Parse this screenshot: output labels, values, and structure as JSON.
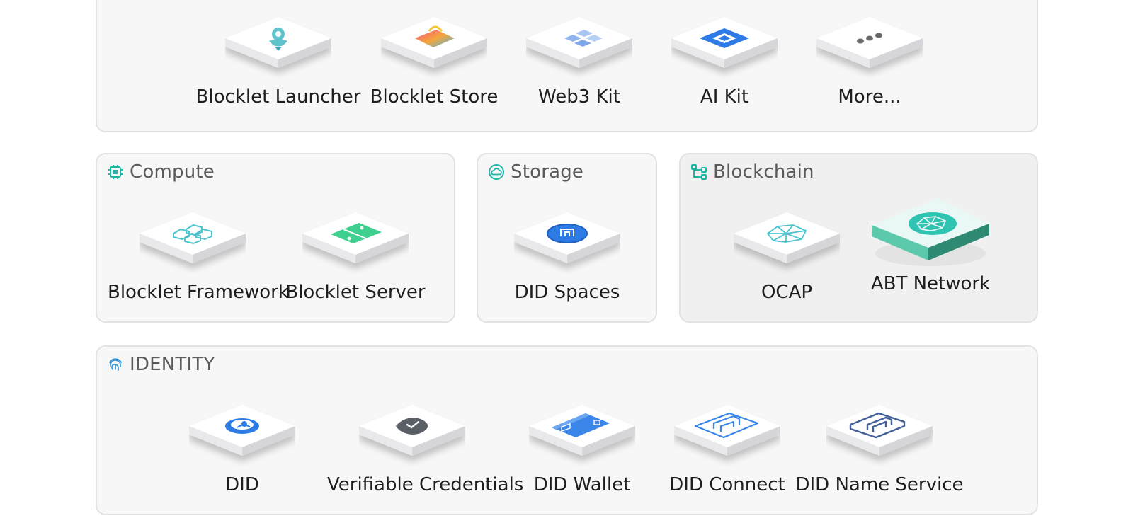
{
  "colors": {
    "panel_bg": "#f7f7f7",
    "panel_border": "#e2e2e2",
    "teal": "#1fb6a6",
    "blue": "#2f7be6",
    "label": "#1e1e1e",
    "header": "#5a5a5a"
  },
  "top_row": {
    "items": [
      {
        "label": "Blocklet Launcher",
        "icon": "rocket-icon"
      },
      {
        "label": "Blocklet Store",
        "icon": "shopping-bag-icon"
      },
      {
        "label": "Web3 Kit",
        "icon": "blocks-icon"
      },
      {
        "label": "AI Kit",
        "icon": "chip-icon"
      },
      {
        "label": "More...",
        "icon": "more-dots-icon"
      }
    ]
  },
  "compute": {
    "title": "Compute",
    "icon": "cpu-icon",
    "items": [
      {
        "label": "Blocklet Framework",
        "icon": "hexagons-icon"
      },
      {
        "label": "Blocklet Server",
        "icon": "server-icon"
      }
    ]
  },
  "storage": {
    "title": "Storage",
    "icon": "cloud-icon",
    "items": [
      {
        "label": "DID Spaces",
        "icon": "did-spaces-icon"
      }
    ]
  },
  "blockchain": {
    "title": "Blockchain",
    "icon": "nodes-icon",
    "items": [
      {
        "label": "OCAP",
        "icon": "polyhedron-icon"
      },
      {
        "label": "ABT Network",
        "icon": "abt-network-icon"
      }
    ]
  },
  "identity": {
    "title": "IDENTITY",
    "icon": "fingerprint-icon",
    "items": [
      {
        "label": "DID",
        "icon": "user-circle-icon"
      },
      {
        "label": "Verifiable Credentials",
        "icon": "shield-check-icon"
      },
      {
        "label": "DID Wallet",
        "icon": "wallet-icon"
      },
      {
        "label": "DID Connect",
        "icon": "did-connect-icon"
      },
      {
        "label": "DID Name Service",
        "icon": "did-name-service-icon"
      }
    ]
  }
}
